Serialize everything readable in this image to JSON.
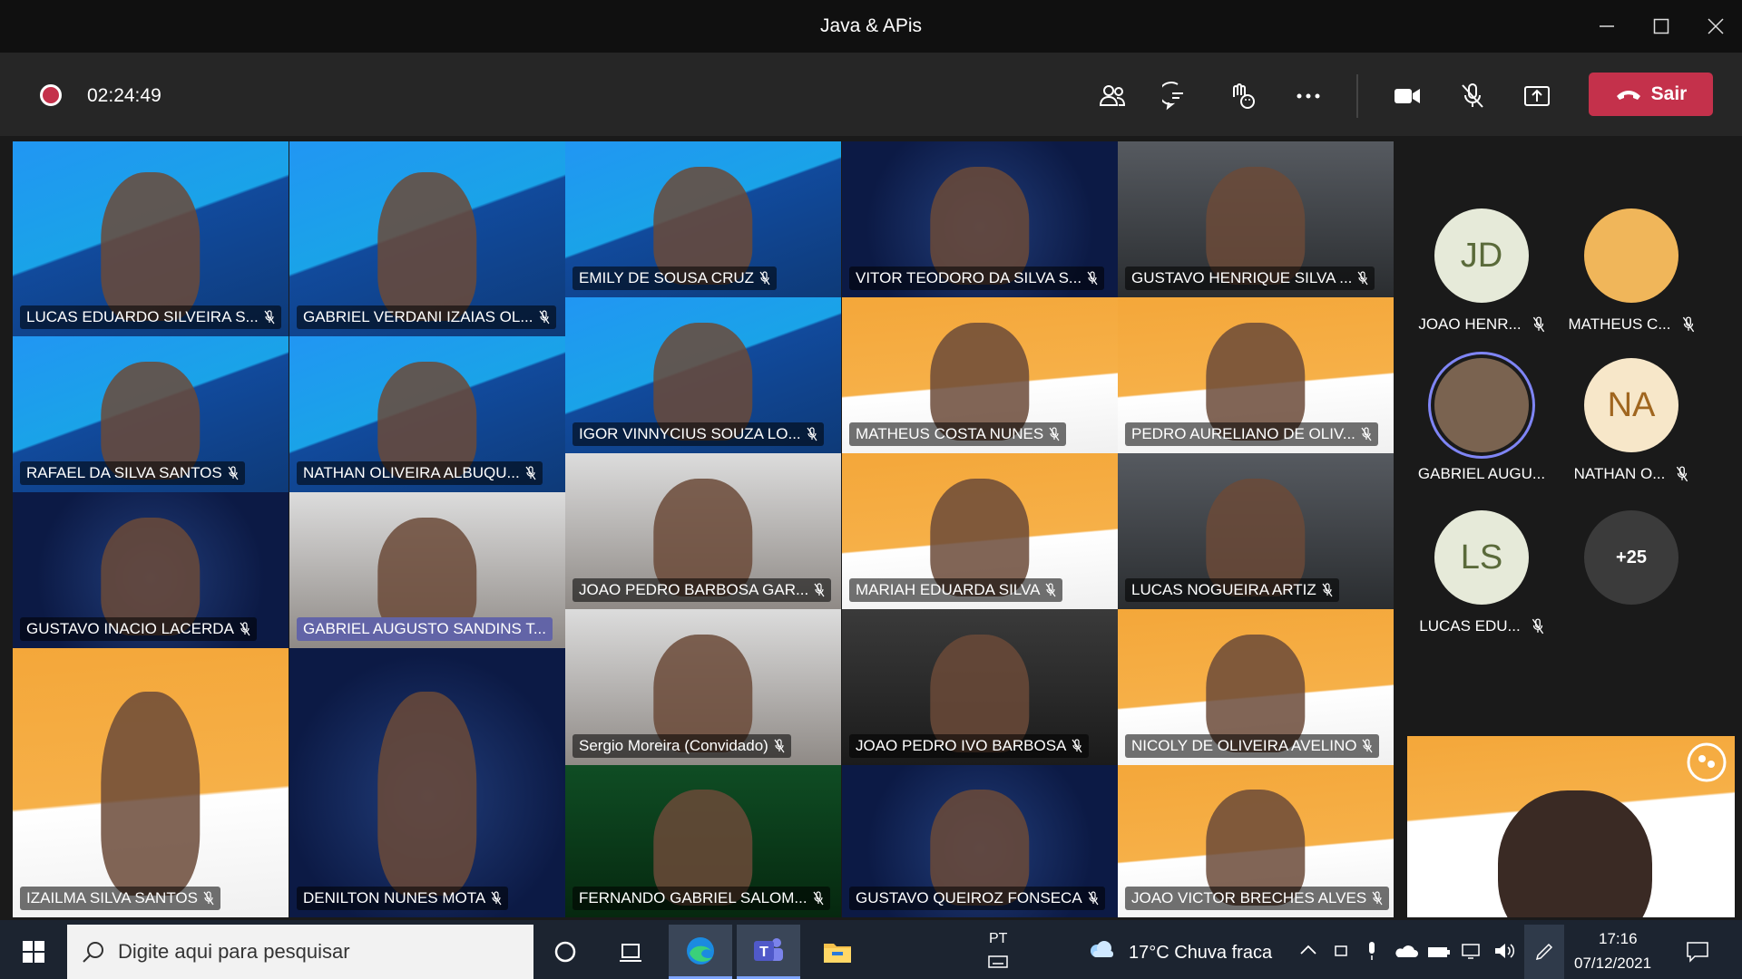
{
  "window": {
    "title": "Java & APis"
  },
  "meeting": {
    "timer": "02:24:49",
    "leave_label": "Sair",
    "toolbar_icons": [
      "participants-icon",
      "chat-icon",
      "reactions-icon",
      "more-options-icon",
      "camera-icon",
      "microphone-muted-icon",
      "share-screen-icon",
      "hang-up-icon"
    ]
  },
  "tiles": [
    {
      "name": "LUCAS EDUARDO SILVEIRA S...",
      "bg": "blue"
    },
    {
      "name": "GABRIEL VERDANI IZAIAS OL...",
      "bg": "blue"
    },
    {
      "name": "EMILY DE SOUSA CRUZ",
      "bg": "blue"
    },
    {
      "name": "VITOR TEODORO DA SILVA S...",
      "bg": "navy"
    },
    {
      "name": "GUSTAVO HENRIQUE SILVA ...",
      "bg": "gray"
    },
    {
      "name": "RAFAEL DA SILVA SANTOS",
      "bg": "blue"
    },
    {
      "name": "NATHAN OLIVEIRA ALBUQU...",
      "bg": "blue"
    },
    {
      "name": "IGOR VINNYCIUS SOUZA LO...",
      "bg": "blue"
    },
    {
      "name": "MATHEUS COSTA NUNES",
      "bg": "orange"
    },
    {
      "name": "PEDRO AURELIANO DE OLIV...",
      "bg": "orange"
    },
    {
      "name": "JOAO PEDRO BARBOSA GAR...",
      "bg": "room"
    },
    {
      "name": "MARIAH EDUARDA SILVA",
      "bg": "orange"
    },
    {
      "name": "LUCAS NOGUEIRA ARTIZ",
      "bg": "gray"
    },
    {
      "name": "GUSTAVO INACIO LACERDA",
      "bg": "navy"
    },
    {
      "name": "GABRIEL AUGUSTO SANDINS T...",
      "bg": "room",
      "active": true
    },
    {
      "name": "Sergio Moreira (Convidado)",
      "bg": "room"
    },
    {
      "name": "JOAO PEDRO IVO BARBOSA",
      "bg": "dark"
    },
    {
      "name": "NICOLY DE OLIVEIRA AVELINO",
      "bg": "orange"
    },
    {
      "name": "IZAILMA SILVA SANTOS",
      "bg": "orange"
    },
    {
      "name": "DENILTON NUNES MOTA",
      "bg": "navy"
    },
    {
      "name": "FERNANDO GABRIEL SALOM...",
      "bg": "green"
    },
    {
      "name": "GUSTAVO QUEIROZ FONSECA",
      "bg": "navy"
    },
    {
      "name": "JOAO VICTOR BRECHES ALVES",
      "bg": "orange"
    }
  ],
  "roster": [
    {
      "initials": "JD",
      "name": "JOAO HENR...",
      "muted": true,
      "bg": "#e6ead9",
      "fg": "#5a6a3a"
    },
    {
      "initials": "",
      "name": "MATHEUS C...",
      "muted": true,
      "bg": "#f0b65a",
      "fg": "#ffffff"
    },
    {
      "initials": "",
      "name": "GABRIEL AUGU...",
      "muted": false,
      "bg": "#7a6350",
      "fg": "#ffffff"
    },
    {
      "initials": "NA",
      "name": "NATHAN O...",
      "muted": true,
      "bg": "#f7e7c9",
      "fg": "#a0661f"
    },
    {
      "initials": "LS",
      "name": "LUCAS EDU...",
      "muted": true,
      "bg": "#e6ead9",
      "fg": "#5a6a3a"
    },
    {
      "initials": "+25",
      "name": "",
      "muted": false,
      "bg": "#3b3b3b",
      "fg": "#ffffff"
    }
  ],
  "taskbar": {
    "search_placeholder": "Digite aqui para pesquisar",
    "language": "PT",
    "weather": "17°C  Chuva fraca",
    "time": "17:16",
    "date": "07/12/2021"
  },
  "colors": {
    "accent": "#6264a7",
    "leave": "#c4314b",
    "record": "#c4314b"
  }
}
